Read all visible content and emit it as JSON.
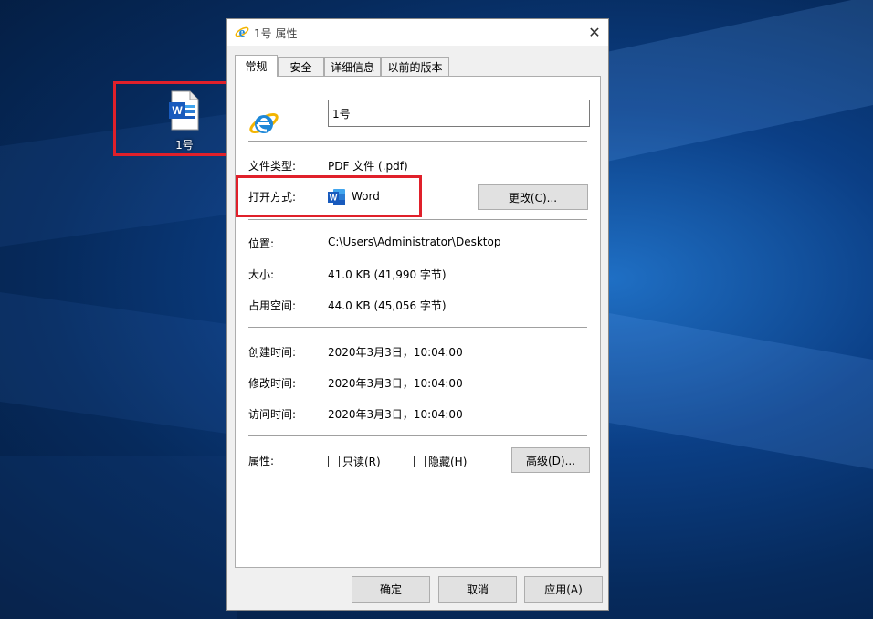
{
  "desktop": {
    "file_label": "1号"
  },
  "dialog": {
    "title": "1号 属性",
    "close_glyph": "✕",
    "tabs": [
      {
        "label": "常规",
        "active": true
      },
      {
        "label": "安全",
        "active": false
      },
      {
        "label": "详细信息",
        "active": false
      },
      {
        "label": "以前的版本",
        "active": false
      }
    ],
    "general": {
      "file_name": "1号",
      "file_type_label": "文件类型:",
      "file_type_value": "PDF 文件 (.pdf)",
      "open_with_label": "打开方式:",
      "open_with_value": "Word",
      "change_button": "更改(C)...",
      "location_label": "位置:",
      "location_value": "C:\\Users\\Administrator\\Desktop",
      "size_label": "大小:",
      "size_value": "41.0 KB (41,990 字节)",
      "size_on_disk_label": "占用空间:",
      "size_on_disk_value": "44.0 KB (45,056 字节)",
      "created_label": "创建时间:",
      "created_value": "2020年3月3日，10:04:00",
      "modified_label": "修改时间:",
      "modified_value": "2020年3月3日，10:04:00",
      "accessed_label": "访问时间:",
      "accessed_value": "2020年3月3日，10:04:00",
      "attributes_label": "属性:",
      "readonly_label": "只读(R)",
      "hidden_label": "隐藏(H)",
      "advanced_button": "高级(D)..."
    },
    "buttons": {
      "ok": "确定",
      "cancel": "取消",
      "apply": "应用(A)"
    }
  },
  "colors": {
    "highlight": "#e0202a",
    "word_blue": "#185abd",
    "ie_blue": "#1e88d8",
    "ie_gold": "#f3b400"
  }
}
